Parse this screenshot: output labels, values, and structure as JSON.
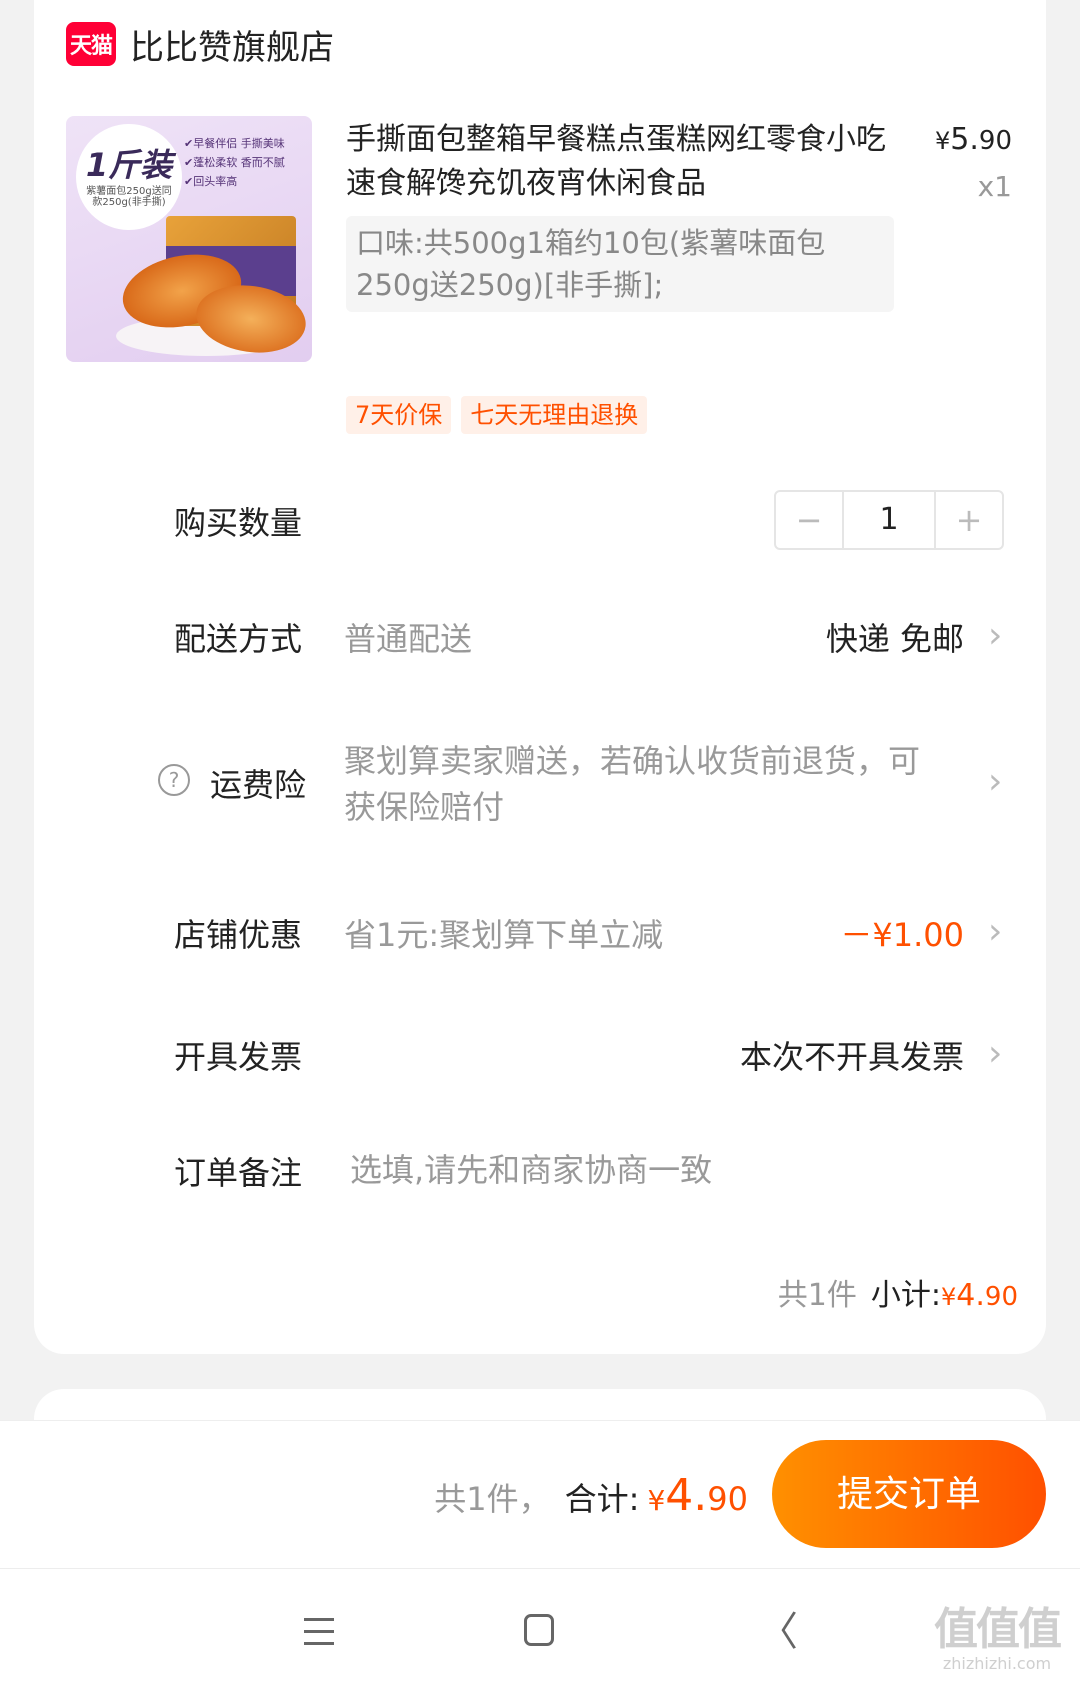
{
  "store": {
    "logo_text": "天猫",
    "name": "比比赞旗舰店"
  },
  "product": {
    "image": {
      "badge_main": "1斤装",
      "badge_sub": "紫薯面包250g送同款250g(非手撕)",
      "features": [
        "早餐伴侣 手撕美味",
        "蓬松柔软 香而不腻",
        "回头率高"
      ]
    },
    "title": "手撕面包整箱早餐糕点蛋糕网红零食小吃速食解馋充饥夜宵休闲食品",
    "price_symbol": "¥",
    "price_int": "5.",
    "price_dec": "90",
    "quantity_label": "x1",
    "sku": "口味:共500g1箱约10包(紫薯味面包250g送250g)[非手撕];",
    "tags": [
      "7天价保",
      "七天无理由退换"
    ]
  },
  "rows": {
    "quantity": {
      "label": "购买数量",
      "minus": "−",
      "value": "1",
      "plus": "+"
    },
    "delivery": {
      "label": "配送方式",
      "sub": "普通配送",
      "value": "快递 免邮"
    },
    "insurance": {
      "label": "运费险",
      "help": "?",
      "desc": "聚划算卖家赠送，若确认收货前退货，可获保险赔付"
    },
    "discount": {
      "label": "店铺优惠",
      "sub": "省1元:聚划算下单立减",
      "value": "－¥1.00"
    },
    "invoice": {
      "label": "开具发票",
      "value": "本次不开具发票"
    },
    "remark": {
      "label": "订单备注",
      "placeholder": "选填,请先和商家协商一致",
      "value": ""
    }
  },
  "subtotal": {
    "count": "共1件",
    "label": "小计:",
    "symbol": "¥",
    "int": "4.",
    "dec": "90"
  },
  "footer": {
    "count": "共1件，",
    "label": "合计:",
    "symbol": "¥",
    "int": "4.",
    "dec": "90",
    "submit": "提交订单"
  },
  "navbar": {
    "menu_icon": "menu-icon",
    "home_icon": "home-icon",
    "back_icon": "back-icon",
    "back_glyph": "〈"
  },
  "watermark": {
    "big": "值值值",
    "small": "zhizhizhi.com"
  },
  "colors": {
    "accent": "#ff5000",
    "button_gradient_start": "#ff9000",
    "button_gradient_end": "#ff5000",
    "tmall_red": "#ff0036",
    "tag_bg": "#fff0e8",
    "page_bg": "#f2f2f2"
  }
}
